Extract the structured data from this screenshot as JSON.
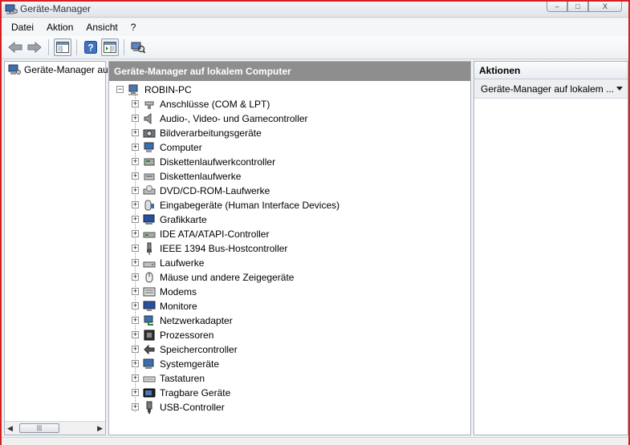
{
  "window": {
    "title": "Geräte-Manager",
    "buttons": {
      "minimize": "–",
      "maximize": "□",
      "close": "X"
    }
  },
  "menu": [
    "Datei",
    "Aktion",
    "Ansicht",
    "?"
  ],
  "toolbar": [
    "back-icon",
    "forward-icon",
    "show-hide-tree-icon",
    "help-icon",
    "show-hide-action-pane-icon",
    "scan-hardware-icon"
  ],
  "left_pane": {
    "node_label": "Geräte-Manager au"
  },
  "main": {
    "header": "Geräte-Manager auf lokalem Computer",
    "root": "ROBIN-PC",
    "categories": [
      {
        "label": "Anschlüsse (COM & LPT)",
        "icon": "port-icon"
      },
      {
        "label": "Audio-, Video- und Gamecontroller",
        "icon": "speaker-icon"
      },
      {
        "label": "Bildverarbeitungsgeräte",
        "icon": "camera-icon"
      },
      {
        "label": "Computer",
        "icon": "computer-icon"
      },
      {
        "label": "Diskettenlaufwerkcontroller",
        "icon": "floppy-controller-icon"
      },
      {
        "label": "Diskettenlaufwerke",
        "icon": "floppy-drive-icon"
      },
      {
        "label": "DVD/CD-ROM-Laufwerke",
        "icon": "dvd-drive-icon"
      },
      {
        "label": "Eingabegeräte (Human Interface Devices)",
        "icon": "hid-icon"
      },
      {
        "label": "Grafikkarte",
        "icon": "display-adapter-icon"
      },
      {
        "label": "IDE ATA/ATAPI-Controller",
        "icon": "ide-controller-icon"
      },
      {
        "label": "IEEE 1394 Bus-Hostcontroller",
        "icon": "firewire-icon"
      },
      {
        "label": "Laufwerke",
        "icon": "disk-drive-icon"
      },
      {
        "label": "Mäuse und andere Zeigegeräte",
        "icon": "mouse-icon"
      },
      {
        "label": "Modems",
        "icon": "modem-icon"
      },
      {
        "label": "Monitore",
        "icon": "monitor-icon"
      },
      {
        "label": "Netzwerkadapter",
        "icon": "network-adapter-icon"
      },
      {
        "label": "Prozessoren",
        "icon": "processor-icon"
      },
      {
        "label": "Speichercontroller",
        "icon": "storage-controller-icon"
      },
      {
        "label": "Systemgeräte",
        "icon": "system-device-icon"
      },
      {
        "label": "Tastaturen",
        "icon": "keyboard-icon"
      },
      {
        "label": "Tragbare Geräte",
        "icon": "portable-device-icon"
      },
      {
        "label": "USB-Controller",
        "icon": "usb-icon"
      }
    ]
  },
  "actions": {
    "header": "Aktionen",
    "item": "Geräte-Manager auf lokalem ..."
  },
  "colors": {
    "frame": "#d42020",
    "pane_header": "#8e8e8e",
    "selection_bg": "#edeff2"
  }
}
